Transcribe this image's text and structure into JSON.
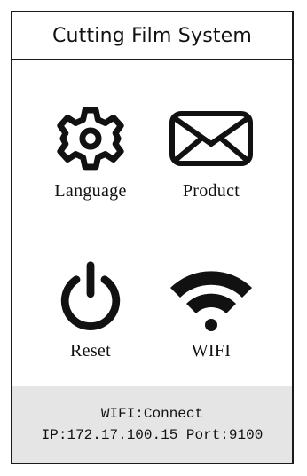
{
  "header": {
    "title": "Cutting Film System"
  },
  "menu": {
    "language": {
      "label": "Language",
      "icon": "gear-icon"
    },
    "product": {
      "label": "Product",
      "icon": "envelope-icon"
    },
    "reset": {
      "label": "Reset",
      "icon": "power-icon"
    },
    "wifi": {
      "label": "WIFI",
      "icon": "wifi-icon"
    }
  },
  "status": {
    "wifi_line": "WIFI:Connect",
    "ip_line": "IP:172.17.100.15 Port:9100"
  },
  "colors": {
    "foreground": "#111111",
    "status_background": "#e5e5e5"
  }
}
